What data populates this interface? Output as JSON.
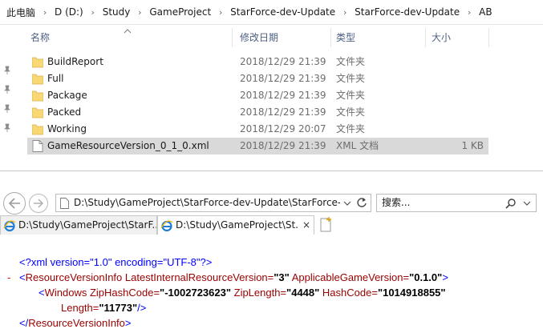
{
  "breadcrumb": [
    "此电脑",
    "D (D:)",
    "Study",
    "GameProject",
    "StarForce-dev-Update",
    "StarForce-dev-Update",
    "AB"
  ],
  "columns": {
    "name": "名称",
    "date": "修改日期",
    "type": "类型",
    "size": "大小"
  },
  "files": [
    {
      "name": "BuildReport",
      "date": "2018/12/29 21:39",
      "type": "文件夹",
      "size": "",
      "icon": "folder-icon",
      "selected": false
    },
    {
      "name": "Full",
      "date": "2018/12/29 21:39",
      "type": "文件夹",
      "size": "",
      "icon": "folder-icon",
      "selected": false
    },
    {
      "name": "Package",
      "date": "2018/12/29 21:39",
      "type": "文件夹",
      "size": "",
      "icon": "folder-icon",
      "selected": false
    },
    {
      "name": "Packed",
      "date": "2018/12/29 21:39",
      "type": "文件夹",
      "size": "",
      "icon": "folder-icon",
      "selected": false
    },
    {
      "name": "Working",
      "date": "2018/12/29 20:07",
      "type": "文件夹",
      "size": "",
      "icon": "folder-icon",
      "selected": false
    },
    {
      "name": "GameResourceVersion_0_1_0.xml",
      "date": "2018/12/29 21:39",
      "type": "XML 文档",
      "size": "1 KB",
      "icon": "xml-file-icon",
      "selected": true
    }
  ],
  "browser": {
    "address": "D:\\Study\\GameProject\\StarForce-dev-Update\\StarForce-d",
    "search_placeholder": "搜索...",
    "tabs": [
      {
        "title": "D:\\Study\\GameProject\\StarF...",
        "active": false
      },
      {
        "title": "D:\\Study\\GameProject\\St...",
        "active": true
      }
    ],
    "close_glyph": "×"
  },
  "xml": {
    "minus": "-",
    "line1": {
      "open": "<?xml version=",
      "ver": "\"1.0\"",
      "enc_attr": " encoding=",
      "enc": "\"UTF-8\"",
      "close": "?>"
    },
    "line2": {
      "lt": "<",
      "tag": "ResourceVersionInfo",
      "a1": " LatestInternalResourceVersion=",
      "v1": "\"3\"",
      "a2": " ApplicableGameVersion=",
      "v2": "\"0.1.0\"",
      "gt": ">"
    },
    "line3": {
      "lt": "<",
      "tag": "Windows",
      "a1": " ZipHashCode=",
      "v1": "\"-1002723623\"",
      "a2": " ZipLength=",
      "v2": "\"4448\"",
      "a3": " HashCode=",
      "v3": "\"1014918855\""
    },
    "line4": {
      "a1": "Length=",
      "v1": "\"11773\"",
      "close": "/>"
    },
    "line5": {
      "open": "</",
      "tag": "ResourceVersionInfo",
      "gt": ">"
    }
  }
}
